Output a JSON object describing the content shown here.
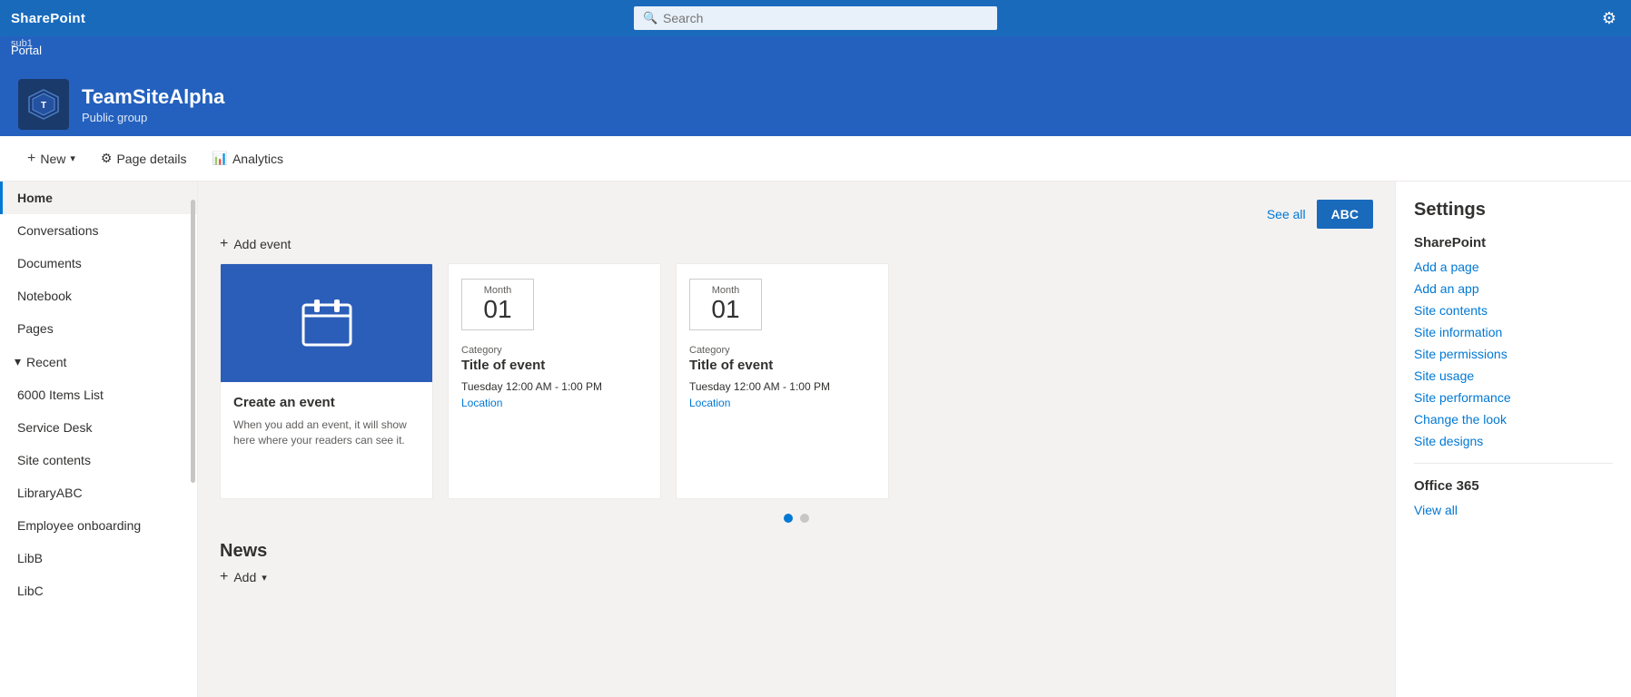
{
  "topbar": {
    "logo": "SharePoint",
    "search_placeholder": "Search",
    "gear_label": "Settings gear"
  },
  "subnav": {
    "portal_label": "Portal",
    "sub_label": "sub1"
  },
  "site": {
    "name": "TeamSiteAlpha",
    "subtitle": "Public group"
  },
  "commandbar": {
    "new_label": "New",
    "page_details_label": "Page details",
    "analytics_label": "Analytics"
  },
  "sidebar": {
    "items": [
      {
        "label": "Home",
        "active": true
      },
      {
        "label": "Conversations",
        "active": false
      },
      {
        "label": "Documents",
        "active": false
      },
      {
        "label": "Notebook",
        "active": false
      },
      {
        "label": "Pages",
        "active": false
      }
    ],
    "recent_label": "Recent",
    "recent_items": [
      {
        "label": "6000 Items List"
      },
      {
        "label": "Service Desk"
      },
      {
        "label": "Site contents"
      },
      {
        "label": "LibraryABC"
      },
      {
        "label": "Employee onboarding"
      },
      {
        "label": "LibB"
      },
      {
        "label": "LibC"
      }
    ]
  },
  "events": {
    "see_all_label": "See all",
    "abc_btn_label": "ABC",
    "add_event_label": "Add event",
    "create_card": {
      "title": "Create an event",
      "description": "When you add an event, it will show here where your readers can see it."
    },
    "event_cards": [
      {
        "month": "Month",
        "day": "01",
        "category": "Category",
        "title": "Title of event",
        "time": "Tuesday 12:00 AM - 1:00 PM",
        "location": "Location"
      },
      {
        "month": "Month",
        "day": "01",
        "category": "Category",
        "title": "Title of event",
        "time": "Tuesday 12:00 AM - 1:00 PM",
        "location": "Location"
      }
    ],
    "dots": [
      {
        "active": true
      },
      {
        "active": false
      }
    ]
  },
  "news": {
    "title": "News",
    "add_label": "Add"
  },
  "settings": {
    "panel_title": "Settings",
    "sharepoint_section": "SharePoint",
    "links": [
      {
        "label": "Add a page"
      },
      {
        "label": "Add an app"
      },
      {
        "label": "Site contents"
      },
      {
        "label": "Site information"
      },
      {
        "label": "Site permissions"
      },
      {
        "label": "Site usage"
      },
      {
        "label": "Site performance"
      },
      {
        "label": "Change the look"
      },
      {
        "label": "Site designs"
      }
    ],
    "office365_section": "Office 365",
    "office365_links": [
      {
        "label": "View all"
      }
    ]
  }
}
